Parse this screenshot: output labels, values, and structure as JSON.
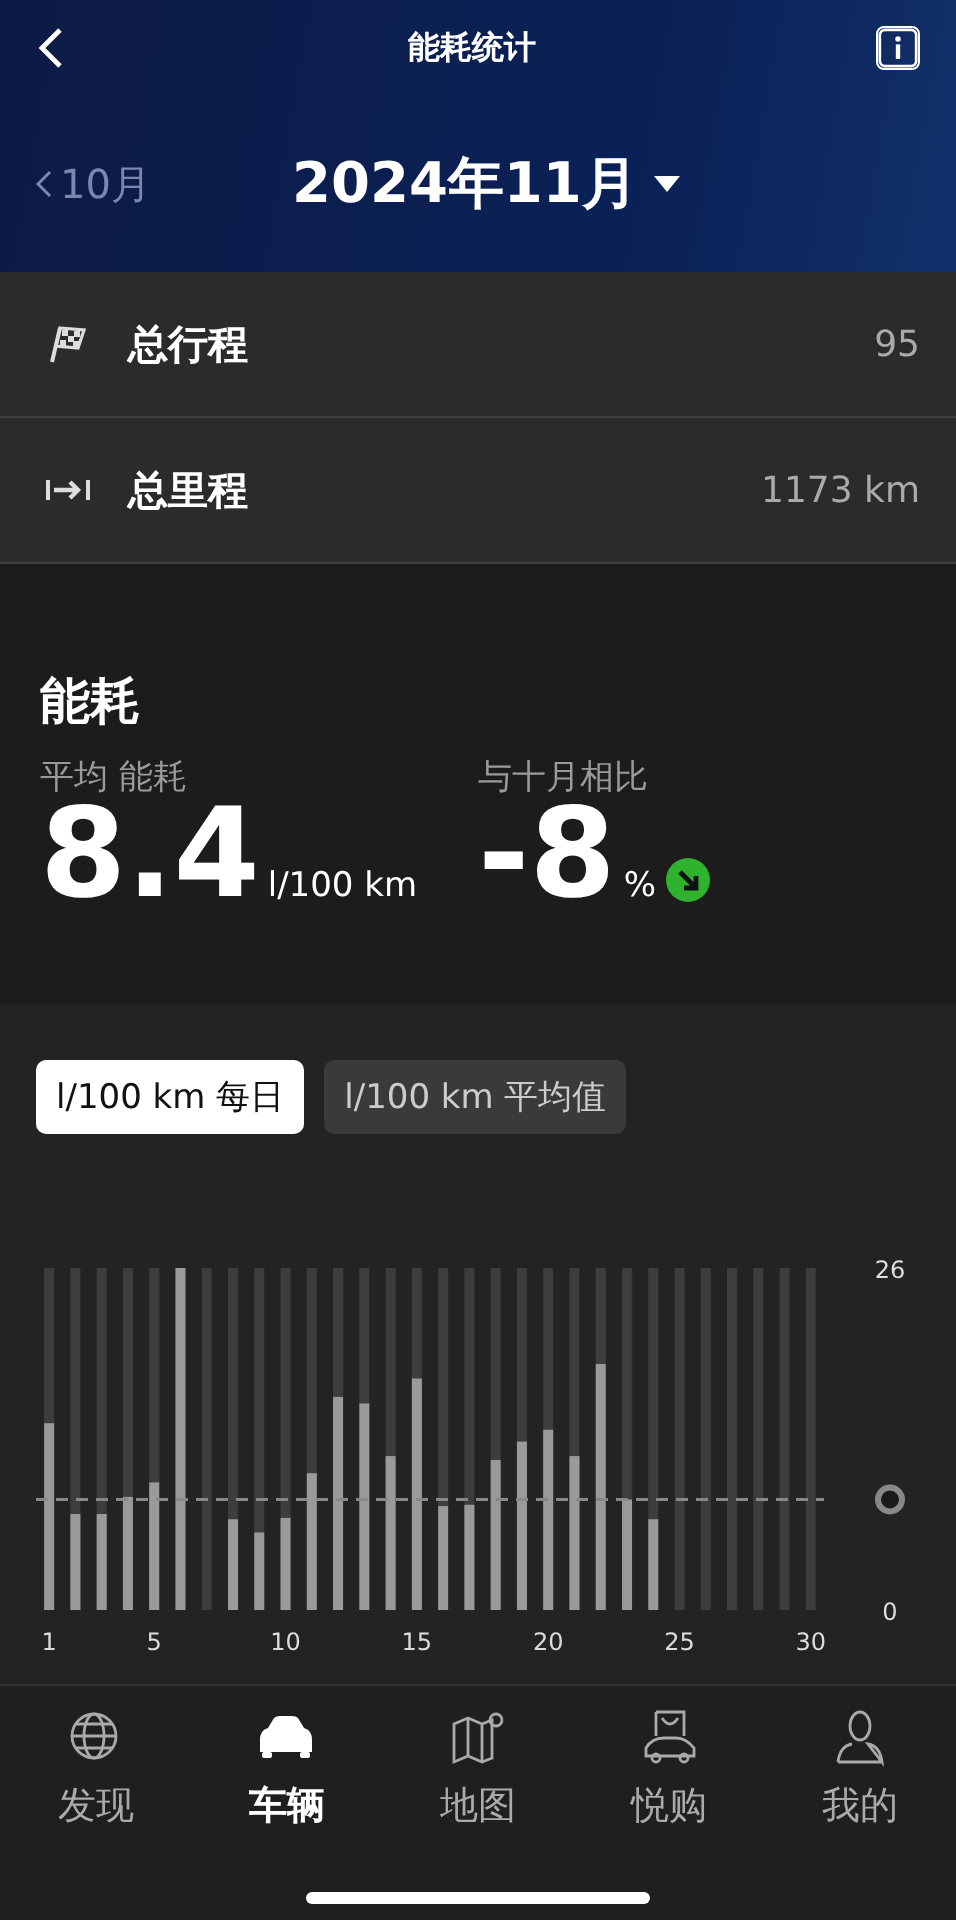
{
  "header": {
    "title": "能耗统计",
    "prev_month": "10月",
    "current_month": "2024年11月"
  },
  "stats": [
    {
      "kind": "flag",
      "label": "总行程",
      "value": "95"
    },
    {
      "kind": "distance",
      "label": "总里程",
      "value": "1173 km"
    }
  ],
  "consumption": {
    "title": "能耗",
    "average": {
      "label": "平均 能耗",
      "value": "8.4",
      "unit": "l/100 km"
    },
    "comparison": {
      "label": "与十月相比",
      "value": "-8",
      "unit": "%",
      "decreased": true
    }
  },
  "chart_tabs": [
    {
      "label": "l/100 km 每日",
      "selected": true
    },
    {
      "label": "l/100 km 平均值",
      "selected": false
    }
  ],
  "chart_data": {
    "type": "bar",
    "x": [
      1,
      2,
      3,
      4,
      5,
      6,
      7,
      8,
      9,
      10,
      11,
      12,
      13,
      14,
      15,
      16,
      17,
      18,
      19,
      20,
      21,
      22,
      23,
      24
    ],
    "values": [
      14.2,
      7.3,
      7.3,
      8.6,
      9.7,
      26,
      null,
      6.9,
      5.9,
      7.0,
      10.4,
      16.2,
      15.7,
      11.7,
      17.6,
      7.9,
      8.0,
      11.4,
      12.8,
      13.7,
      11.7,
      18.7,
      8.4,
      6.9
    ],
    "xlim": [
      0.5,
      30.5
    ],
    "ylim": [
      0,
      26
    ],
    "yticks": [
      0,
      26
    ],
    "xticks": [
      1,
      5,
      10,
      15,
      20,
      25,
      30
    ],
    "ref_lines": [
      {
        "axis": "y",
        "value": 8.4
      }
    ]
  },
  "nav": [
    {
      "kind": "globe",
      "label": "发现",
      "selected": false
    },
    {
      "kind": "car",
      "label": "车辆",
      "selected": true
    },
    {
      "kind": "map",
      "label": "地图",
      "selected": false
    },
    {
      "kind": "shop",
      "label": "悦购",
      "selected": false
    },
    {
      "kind": "person",
      "label": "我的",
      "selected": false
    }
  ]
}
